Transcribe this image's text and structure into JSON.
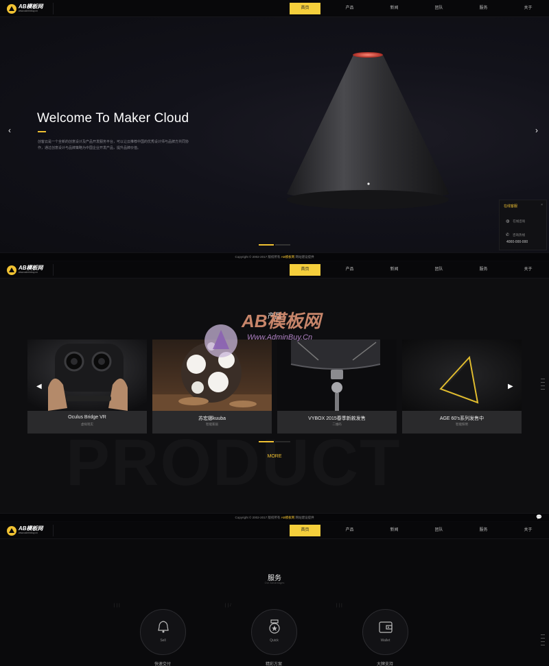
{
  "nav": {
    "logo_name": "AB模板网",
    "logo_sub": "www.adminbuy.cn",
    "items": [
      "首页",
      "产品",
      "新闻",
      "团队",
      "服务",
      "关于"
    ]
  },
  "hero": {
    "title": "Welcome To Maker Cloud",
    "desc": "创客云是一个全新的创意设计及产品开发服务平台，可以让云推荐中国的优秀设计师与品牌方共同协作，通过创意设计与品牌策略为中国企业开发产品，提升品牌价值。",
    "prev": "‹",
    "next": "›"
  },
  "online": {
    "title": "在线客服",
    "close": "×",
    "qq": "在线咨询",
    "phone_label": "咨询热线",
    "phone": "4000-000-000"
  },
  "footer": {
    "copy": "Copyright © 2002-2017 版权所有",
    "brand": "AB模板网",
    "tail": "网站建设提供"
  },
  "product": {
    "title": "产品",
    "subtitle": "Product",
    "bg_text": "PRODUCT",
    "more": "MORE",
    "cards": [
      {
        "name": "Oculus Bridge VR",
        "sub": "虚拟现实"
      },
      {
        "name": "苏宏娜kuuba",
        "sub": "智能家居"
      },
      {
        "name": "VYBOX 2015春季新款发售",
        "sub": "二维码"
      },
      {
        "name": "AGE 60's系列发售中",
        "sub": "智能照明"
      }
    ]
  },
  "watermark": {
    "brand": "AB模板网",
    "url": "Www.AdminBuy.Cn"
  },
  "service": {
    "title": "服务",
    "subtitle": "Our Advantages",
    "items": [
      {
        "label": "Sell",
        "caption": "快速交付"
      },
      {
        "label": "Quick",
        "caption": "精彩方案"
      },
      {
        "label": "Wallet",
        "caption": "大牌支持"
      }
    ]
  }
}
